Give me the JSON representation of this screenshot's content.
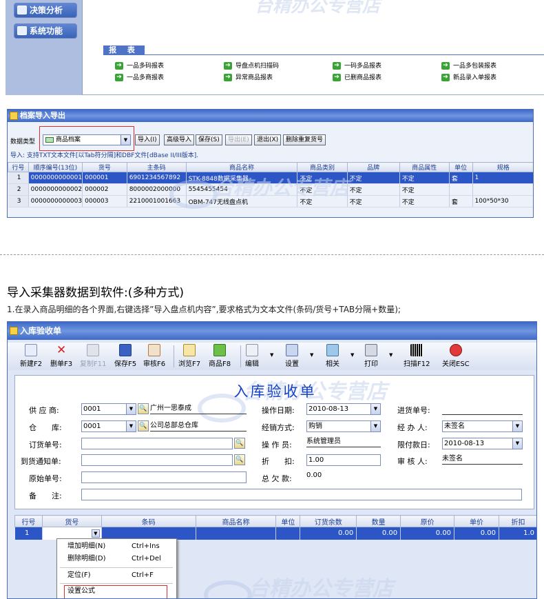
{
  "nav": {
    "decision_label": "决策分析",
    "system_label": "系统功能"
  },
  "reports": {
    "tab_label": "报 表",
    "items": [
      {
        "label": "一品多码报表"
      },
      {
        "label": "导盘点机扫描码"
      },
      {
        "label": "一码多品报表"
      },
      {
        "label": "一品多包装报表"
      },
      {
        "label": "一品多商报表"
      },
      {
        "label": "异常商品报表"
      },
      {
        "label": "已删商品报表"
      },
      {
        "label": "新品录入单报表"
      }
    ]
  },
  "import_window": {
    "title": "档案导入导出",
    "type_label": "数据类型",
    "type_value": "商品档案",
    "buttons": {
      "import": "导入(I)",
      "advanced": "高级导入",
      "save": "保存(S)",
      "export": "导出(E)",
      "exit": "退出(X)",
      "dedupe": "删除重复货号"
    },
    "hint": "导入: 支持TXT文本文件[以Tab符分隔]和DBF文件[dBase II/III版本].",
    "columns": [
      "行号",
      "顺序编号(13位)",
      "货号",
      "主条码",
      "商品名称",
      "商品类别",
      "品牌",
      "商品属性",
      "单位",
      "规格"
    ],
    "rows": [
      [
        "1",
        "0000000000001",
        "000001",
        "6901234567892",
        "STK-8848数据采集器",
        "不定",
        "不定",
        "不定",
        "套",
        "1"
      ],
      [
        "2",
        "0000000000002",
        "000002",
        "8000002000000",
        "5545455454",
        "不定",
        "不定",
        "不定",
        "",
        ""
      ],
      [
        "3",
        "0000000000003",
        "000003",
        "2210001001663",
        "OBM-747无线盘点机",
        "不定",
        "不定",
        "不定",
        "套",
        "100*50*30"
      ]
    ]
  },
  "section": {
    "heading": "导入采集器数据到软件:(多种方式)",
    "desc": "1.在录入商品明细的各个界面,右键选择”导入盘点机内容”,要求格式为文本文件(条码/货号+TAB分隔+数量);"
  },
  "receipt_window": {
    "title": "入库验收单",
    "toolbar": [
      {
        "label": "新建F2"
      },
      {
        "label": "删单F3"
      },
      {
        "label": "复制F11"
      },
      {
        "label": "保存F5"
      },
      {
        "label": "审核F6"
      },
      {
        "label": "浏览F7"
      },
      {
        "label": "商品F8"
      },
      {
        "label": "编辑"
      },
      {
        "label": "设置"
      },
      {
        "label": "相关"
      },
      {
        "label": "打印"
      },
      {
        "label": "扫描F12"
      },
      {
        "label": "关闭ESC"
      }
    ],
    "form_title": "入库验收单",
    "fields": {
      "supplier_label": "供 应 商:",
      "supplier_code": "0001",
      "supplier_name": "广州一思泰成",
      "warehouse_label": "仓　　库:",
      "warehouse_code": "0001",
      "warehouse_name": "公司总部总仓库",
      "order_no_label": "订货单号:",
      "arrival_label": "到货通知单:",
      "original_label": "原始单号:",
      "remark_label": "备　　注:",
      "op_date_label": "操作日期:",
      "op_date": "2010-08-13",
      "mode_label": "经销方式:",
      "mode": "购销",
      "operator_label": "操 作 员:",
      "operator": "系统管理员",
      "discount_label": "折　　扣:",
      "discount": "1.00",
      "owed_label": "总 欠 款:",
      "owed": "0.00",
      "purchase_no_label": "进货单号:",
      "handler_label": "经 办 人:",
      "handler": "未签名",
      "deadline_label": "限付款日:",
      "deadline": "2010-08-13",
      "reviewer_label": "审 核 人:",
      "reviewer": "未签名"
    },
    "grid_columns": [
      "行号",
      "货号",
      "条码",
      "商品名称",
      "单位",
      "订货余数",
      "数量",
      "原价",
      "单价",
      "折扣"
    ],
    "grid_row": [
      "1",
      "",
      "",
      "",
      "",
      "0.00",
      "0.00",
      "0.00",
      "0.00",
      "1.0"
    ],
    "context_menu": [
      {
        "label": "增加明细(N)",
        "shortcut": "Ctrl+Ins"
      },
      {
        "label": "删除明细(D)",
        "shortcut": "Ctrl+Del"
      },
      {
        "label": "定位(F)",
        "shortcut": "Ctrl+F"
      },
      {
        "label": "设置公式",
        "shortcut": ""
      }
    ]
  },
  "watermark": "台精办公专营店",
  "colors": {
    "accent": "#2c55c5",
    "title_blue": "#1542c7",
    "highlight_red": "#e32a2a"
  }
}
